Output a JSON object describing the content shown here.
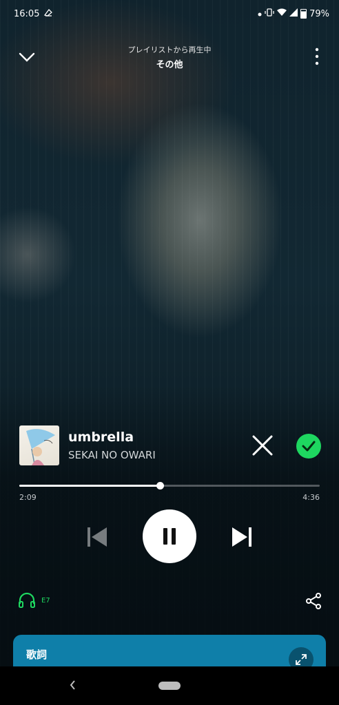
{
  "status_bar": {
    "time": "16:05",
    "battery": "79%",
    "icons": [
      "app-notification-icon",
      "dot-icon",
      "vibrate-icon",
      "wifi-icon",
      "signal-icon",
      "battery-icon"
    ]
  },
  "header": {
    "context_label": "プレイリストから再生中",
    "context_name": "その他"
  },
  "track": {
    "title": "umbrella",
    "artist": "SEKAI NO OWARI",
    "liked": true
  },
  "progress": {
    "elapsed": "2:09",
    "total": "4:36",
    "fraction": 0.467
  },
  "device": {
    "label": "E7"
  },
  "lyrics": {
    "title": "歌詞"
  },
  "colors": {
    "accent": "#1ed760",
    "lyrics_card": "#0f7fa9",
    "background": "#0b1a22"
  }
}
